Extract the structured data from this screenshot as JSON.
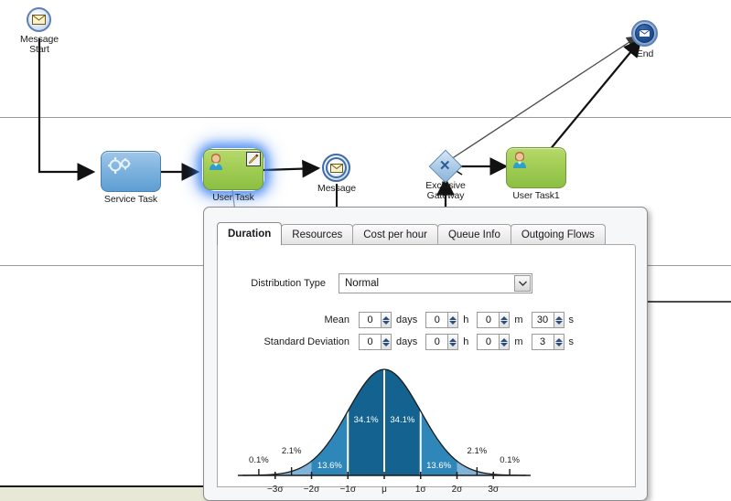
{
  "diagram": {
    "nodes": [
      {
        "id": "message-start",
        "label": "Message\nStart",
        "type": "start-message-event"
      },
      {
        "id": "service-task",
        "label": "Service Task",
        "type": "service-task"
      },
      {
        "id": "user-task",
        "label": "User Task",
        "type": "user-task",
        "selected": true
      },
      {
        "id": "message-event",
        "label": "Message",
        "type": "intermediate-message-event"
      },
      {
        "id": "exclusive-gateway",
        "label": "Exclusive\nGateway",
        "type": "exclusive-gateway",
        "symbol": "✕"
      },
      {
        "id": "user-task-1",
        "label": "User Task1",
        "type": "user-task"
      },
      {
        "id": "end-event",
        "label": "End",
        "type": "end-message-event"
      }
    ]
  },
  "dialog": {
    "tabs": [
      {
        "id": "duration",
        "label": "Duration",
        "active": true
      },
      {
        "id": "resources",
        "label": "Resources",
        "active": false
      },
      {
        "id": "cost-per-hour",
        "label": "Cost per hour",
        "active": false
      },
      {
        "id": "queue-info",
        "label": "Queue Info",
        "active": false
      },
      {
        "id": "outgoing-flows",
        "label": "Outgoing Flows",
        "active": false
      }
    ],
    "duration": {
      "distribution_label": "Distribution Type",
      "distribution_value": "Normal",
      "distribution_options": [
        "Normal"
      ],
      "rows": [
        {
          "label": "Mean",
          "fields": [
            {
              "value": "0",
              "unit": "days"
            },
            {
              "value": "0",
              "unit": "h"
            },
            {
              "value": "0",
              "unit": "m"
            },
            {
              "value": "30",
              "unit": "s"
            }
          ]
        },
        {
          "label": "Standard Deviation",
          "fields": [
            {
              "value": "0",
              "unit": "days"
            },
            {
              "value": "0",
              "unit": "h"
            },
            {
              "value": "0",
              "unit": "m"
            },
            {
              "value": "3",
              "unit": "s"
            }
          ]
        }
      ]
    }
  },
  "chart_data": {
    "type": "area",
    "title": "",
    "xlabel": "",
    "ylabel": "",
    "distribution": "normal",
    "grid": false,
    "legend": false,
    "xlim": [
      -3.9,
      3.9
    ],
    "x_ticks": [
      "−3σ",
      "−2σ",
      "−1σ",
      "μ",
      "1σ",
      "2σ",
      "3σ"
    ],
    "x_tick_values": [
      -3,
      -2,
      -1,
      0,
      1,
      2,
      3
    ],
    "bands": [
      {
        "range": [
          -3.9,
          -3
        ],
        "label": "0.1%",
        "value": 0.1,
        "color": "#1b1b1b",
        "shade": "none"
      },
      {
        "range": [
          -3,
          -2
        ],
        "label": "2.1%",
        "value": 2.1,
        "color": "#1b1b1b",
        "shade": "light"
      },
      {
        "range": [
          -2,
          -1
        ],
        "label": "13.6%",
        "value": 13.6,
        "color": "#ffffff",
        "shade": "mid"
      },
      {
        "range": [
          -1,
          0
        ],
        "label": "34.1%",
        "value": 34.1,
        "color": "#ffffff",
        "shade": "dark"
      },
      {
        "range": [
          0,
          1
        ],
        "label": "34.1%",
        "value": 34.1,
        "color": "#ffffff",
        "shade": "dark"
      },
      {
        "range": [
          1,
          2
        ],
        "label": "13.6%",
        "value": 13.6,
        "color": "#ffffff",
        "shade": "mid"
      },
      {
        "range": [
          2,
          3
        ],
        "label": "2.1%",
        "value": 2.1,
        "color": "#1b1b1b",
        "shade": "light"
      },
      {
        "range": [
          3,
          3.9
        ],
        "label": "0.1%",
        "value": 0.1,
        "color": "#1b1b1b",
        "shade": "none"
      }
    ],
    "colors": {
      "dark": "#13628F",
      "mid": "#2E87B8",
      "light": "#7FB3D7",
      "curve": "#1b1b1b",
      "axis": "#1b1b1b"
    }
  },
  "theme": {
    "task_service_fill": "#7fb3df",
    "task_user_fill": "#a2cd55",
    "gateway_fill": "#a9c9e6",
    "selection_glow": "#3c82f0",
    "lane_line": "#9a9a9a",
    "band_fill": "#e8e8d6"
  }
}
